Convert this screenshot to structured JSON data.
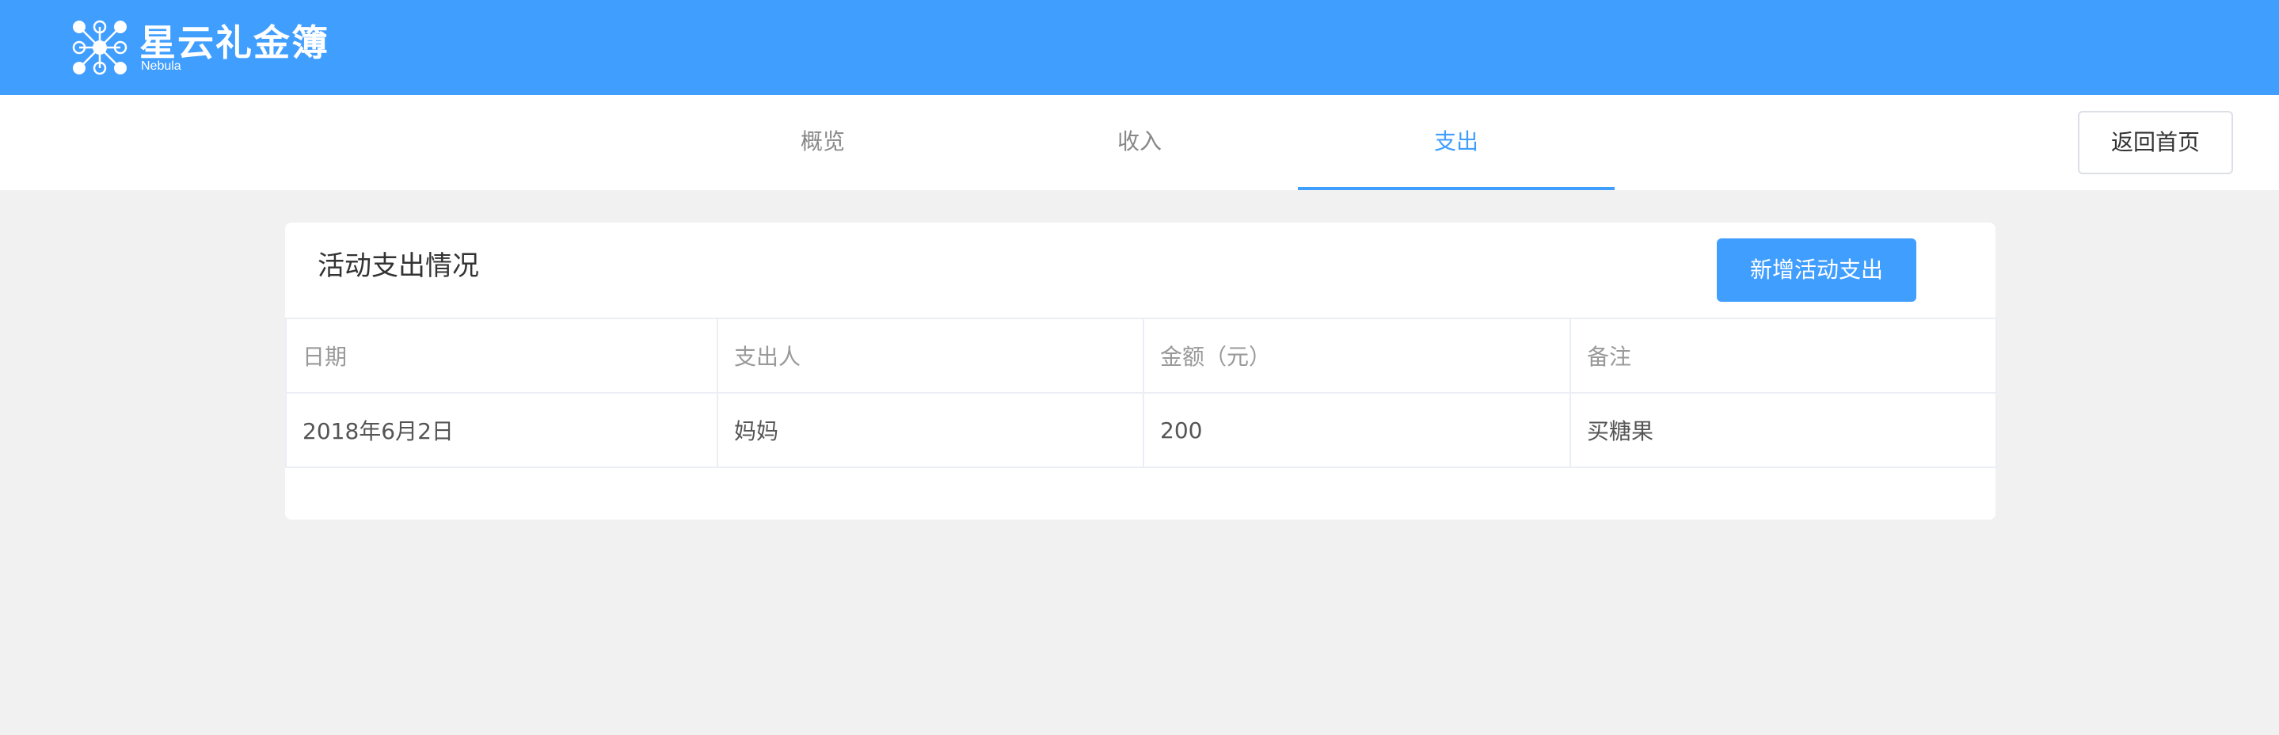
{
  "header": {
    "logo_title": "星云礼金簿",
    "logo_subtitle": "Nebula",
    "brand_color": "#409eff"
  },
  "nav": {
    "tabs": [
      {
        "label": "概览",
        "active": false
      },
      {
        "label": "收入",
        "active": false
      },
      {
        "label": "支出",
        "active": true
      }
    ],
    "home_button": "返回首页"
  },
  "card": {
    "title": "活动支出情况",
    "add_button": "新增活动支出",
    "table": {
      "columns": [
        "日期",
        "支出人",
        "金额（元）",
        "备注"
      ],
      "rows": [
        [
          "2018年6月2日",
          "妈妈",
          "200",
          "买糖果"
        ]
      ]
    }
  }
}
